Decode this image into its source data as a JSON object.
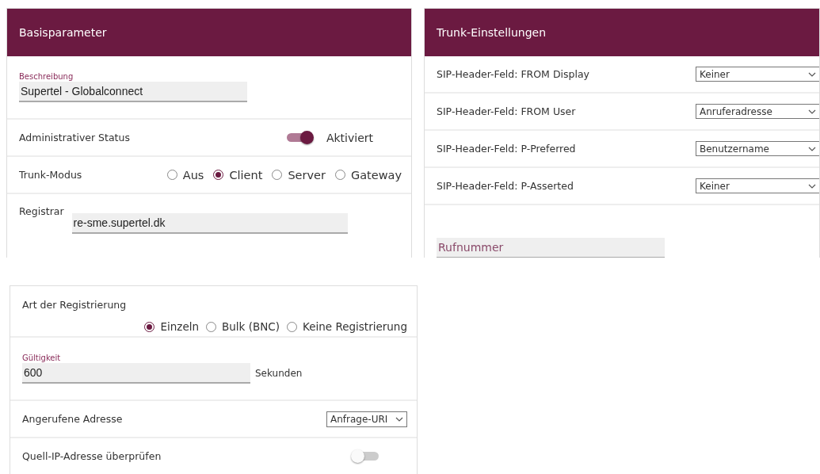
{
  "panels": [
    {
      "title": "Basisparameter",
      "rows": [
        {
          "kind": "field",
          "label": "Beschreibung",
          "value": "Supertel - Globalconnect"
        },
        {
          "kind": "toggle",
          "label": "Administrativer Status",
          "on": true,
          "status": "Aktiviert"
        },
        {
          "kind": "radio",
          "label": "Trunk-Modus",
          "options": [
            {
              "label": "Aus",
              "selected": false
            },
            {
              "label": "Client",
              "selected": true
            },
            {
              "label": "Server",
              "selected": false
            },
            {
              "label": "Gateway",
              "selected": false
            }
          ]
        },
        {
          "kind": "inline_field",
          "label": "Registrar",
          "value": "re-sme.supertel.dk"
        }
      ]
    },
    {
      "title": "Trunk-Einstellungen",
      "rows": [
        {
          "kind": "select",
          "label": "SIP-Header-Feld: FROM Display",
          "value": "Keiner"
        },
        {
          "kind": "select",
          "label": "SIP-Header-Feld: FROM User",
          "value": "Anruferadresse"
        },
        {
          "kind": "select",
          "label": "SIP-Header-Feld: P-Preferred",
          "value": "Benutzername"
        },
        {
          "kind": "select",
          "label": "SIP-Header-Feld: P-Asserted",
          "value": "Keiner"
        },
        {
          "kind": "field",
          "placeholder": "Rufnummer"
        }
      ]
    },
    {
      "rows": [
        {
          "kind": "radio_stacked",
          "label": "Art der Registrierung",
          "options": [
            {
              "label": "Einzeln",
              "selected": true
            },
            {
              "label": "Bulk (BNC)",
              "selected": false
            },
            {
              "label": "Keine Registrierung",
              "selected": false
            }
          ]
        },
        {
          "kind": "field",
          "label": "Gültigkeit",
          "value": "600",
          "unit": "Sekunden"
        },
        {
          "kind": "compact_select",
          "label": "Angerufene Adresse",
          "value": "Anfrage-URI"
        },
        {
          "kind": "toggle",
          "label": "Quell-IP-Adresse überprüfen",
          "on": false
        }
      ]
    }
  ]
}
